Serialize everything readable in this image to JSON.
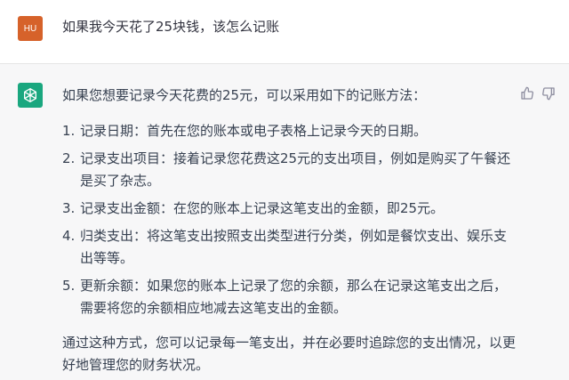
{
  "user": {
    "avatar_initials": "HU",
    "avatar_color": "#d6622a",
    "message": "如果我今天花了25块钱，该怎么记账"
  },
  "assistant": {
    "avatar_icon": "openai-logo-icon",
    "avatar_color": "#1aa77f",
    "intro": "如果您想要记录今天花费的25元，可以采用如下的记账方法：",
    "steps": [
      {
        "num": "1.",
        "text": "记录日期：首先在您的账本或电子表格上记录今天的日期。"
      },
      {
        "num": "2.",
        "text": "记录支出项目：接着记录您花费这25元的支出项目，例如是购买了午餐还是买了杂志。"
      },
      {
        "num": "3.",
        "text": "记录支出金额：在您的账本上记录这笔支出的金额，即25元。"
      },
      {
        "num": "4.",
        "text": "归类支出：将这笔支出按照支出类型进行分类，例如是餐饮支出、娱乐支出等等。"
      },
      {
        "num": "5.",
        "text": "更新余额：如果您的账本上记录了您的余额，那么在记录这笔支出之后，需要将您的余额相应地减去这笔支出的金额。"
      }
    ],
    "outro": "通过这种方式，您可以记录每一笔支出，并在必要时追踪您的支出情况，以更好地管理您的财务状况。"
  },
  "feedback": {
    "thumbs_up_icon": "thumbs-up-icon",
    "thumbs_down_icon": "thumbs-down-icon"
  }
}
